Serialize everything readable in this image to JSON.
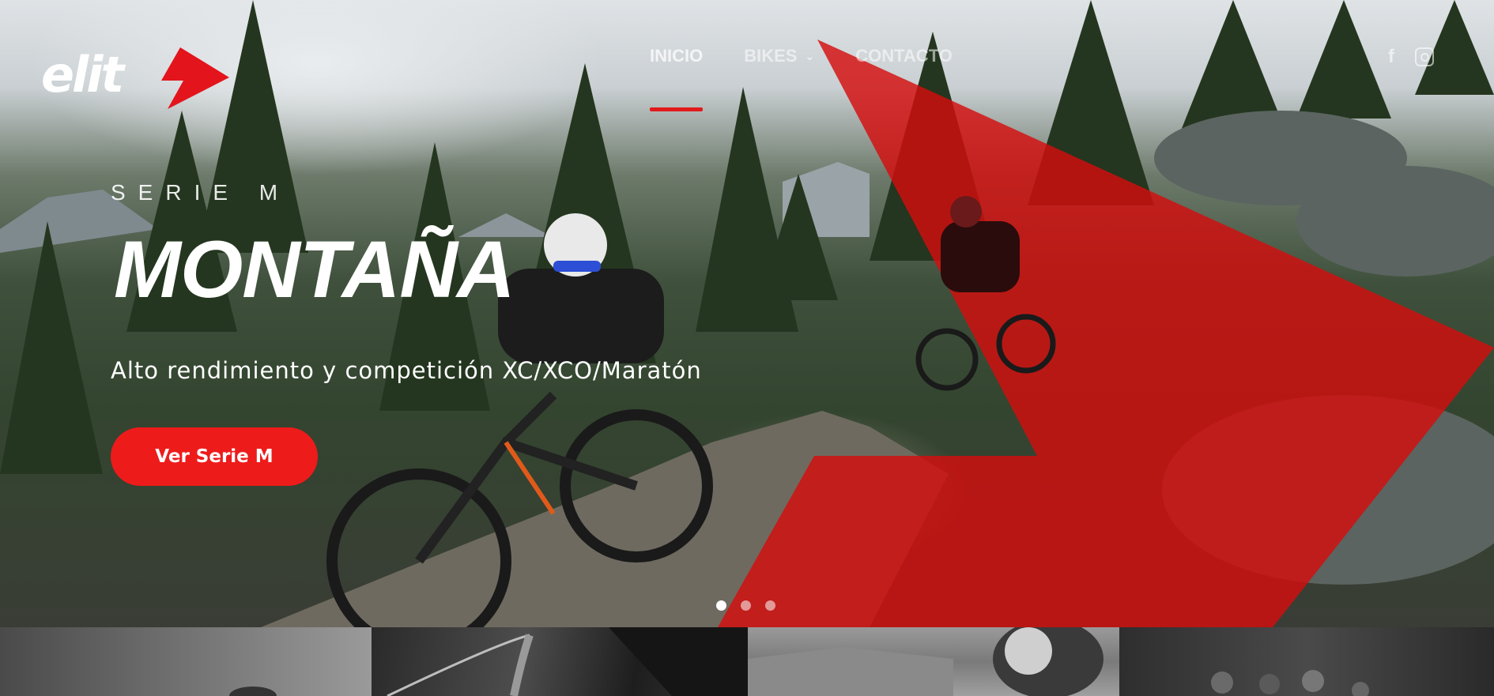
{
  "brand": {
    "logo_text": "elit"
  },
  "nav": {
    "items": [
      {
        "label": "INICIO",
        "active": true
      },
      {
        "label": "BIKES",
        "has_dropdown": true
      },
      {
        "label": "CONTACTO"
      }
    ]
  },
  "social": {
    "facebook_glyph": "f",
    "icons": [
      "facebook-icon",
      "instagram-icon"
    ]
  },
  "hero": {
    "kicker": "SERIE M",
    "title": "MONTAÑA",
    "subtitle": "Alto rendimiento y competición XC/XCO/Maratón",
    "cta_label": "Ver Serie M"
  },
  "slider": {
    "slide_count": 3,
    "active_index": 0
  },
  "colors": {
    "accent": "#ee1b1b",
    "text": "#ffffff"
  }
}
